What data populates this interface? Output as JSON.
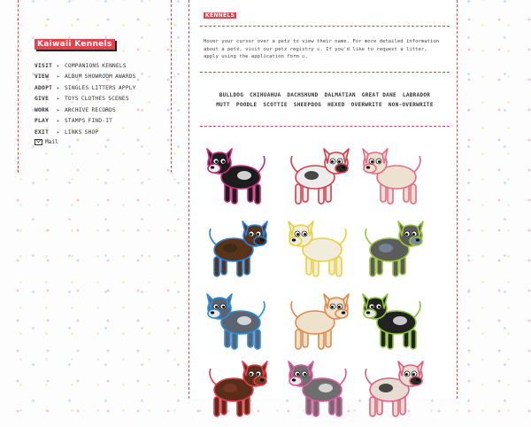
{
  "sidebar": {
    "brand": "Kaiwaii Kennels",
    "nav": [
      {
        "key": "VISIT",
        "links": [
          "COMPANIONS",
          "KENNELS"
        ]
      },
      {
        "key": "VIEW",
        "links": [
          "ALBUM",
          "SHOWROOM",
          "AWARDS"
        ]
      },
      {
        "key": "ADOPT",
        "links": [
          "SINGLES",
          "LITTERS",
          "APPLY"
        ]
      },
      {
        "key": "GIVE",
        "links": [
          "TOYS",
          "CLOTHES",
          "SCENES"
        ]
      },
      {
        "key": "WORK",
        "links": [
          "ARCHIVE",
          "RECORDS"
        ]
      },
      {
        "key": "PLAY",
        "links": [
          "STAMPS",
          "FIND-IT"
        ]
      },
      {
        "key": "EXIT",
        "links": [
          "LINKS",
          "SHOP"
        ]
      }
    ],
    "mail_label": "Mail"
  },
  "main": {
    "title": "KENNELS",
    "intro": "Hover your cursor over a petz to view their name. For more detailed information about a petz, visit our petz registry ☑. If you'd like to request a litter, apply using the application form ☑.",
    "breeds_row1": [
      "BULLDOG",
      "CHIHUAHUA",
      "DACHSHUND",
      "DALMATIAN",
      "GREAT DANE",
      "LABRADOR"
    ],
    "breeds_row2": [
      "MUTT",
      "POODLE",
      "SCOTTIE",
      "SHEEPDOG",
      "HEXED",
      "OVERWRITE",
      "NON-OVERWRITE"
    ]
  },
  "dogs": [
    {
      "name": "dog-1",
      "body": "#1c1c1c",
      "patch": "#f1f1f1",
      "outline": "#c0307a"
    },
    {
      "name": "dog-2",
      "body": "#ececec",
      "patch": "#2a2a2a",
      "outline": "#d2404a"
    },
    {
      "name": "dog-3",
      "body": "#ece2cf",
      "patch": "#ece2cf",
      "outline": "#e86a8a"
    },
    {
      "name": "dog-4",
      "body": "#5a3418",
      "patch": "#3a2a1a",
      "outline": "#2c7fd8"
    },
    {
      "name": "dog-5",
      "body": "#f1ecdc",
      "patch": "#f1ecdc",
      "outline": "#e8d23a"
    },
    {
      "name": "dog-6",
      "body": "#5c5c5c",
      "patch": "#7b8a9a",
      "outline": "#9ac43a"
    },
    {
      "name": "dog-7",
      "body": "#5b6470",
      "patch": "#e8e8e8",
      "outline": "#2c8fe0"
    },
    {
      "name": "dog-8",
      "body": "#efe2cc",
      "patch": "#efe2cc",
      "outline": "#e08a4a"
    },
    {
      "name": "dog-9",
      "body": "#222222",
      "patch": "#e8e8e8",
      "outline": "#8cc23a"
    },
    {
      "name": "dog-10",
      "body": "#5a2c1c",
      "patch": "#7a3a24",
      "outline": "#e0404a"
    },
    {
      "name": "dog-11",
      "body": "#6e6e6e",
      "patch": "#e8e8e8",
      "outline": "#e05aa0"
    },
    {
      "name": "dog-12",
      "body": "#e6dcd2",
      "patch": "#2a2a2a",
      "outline": "#e06080"
    }
  ]
}
